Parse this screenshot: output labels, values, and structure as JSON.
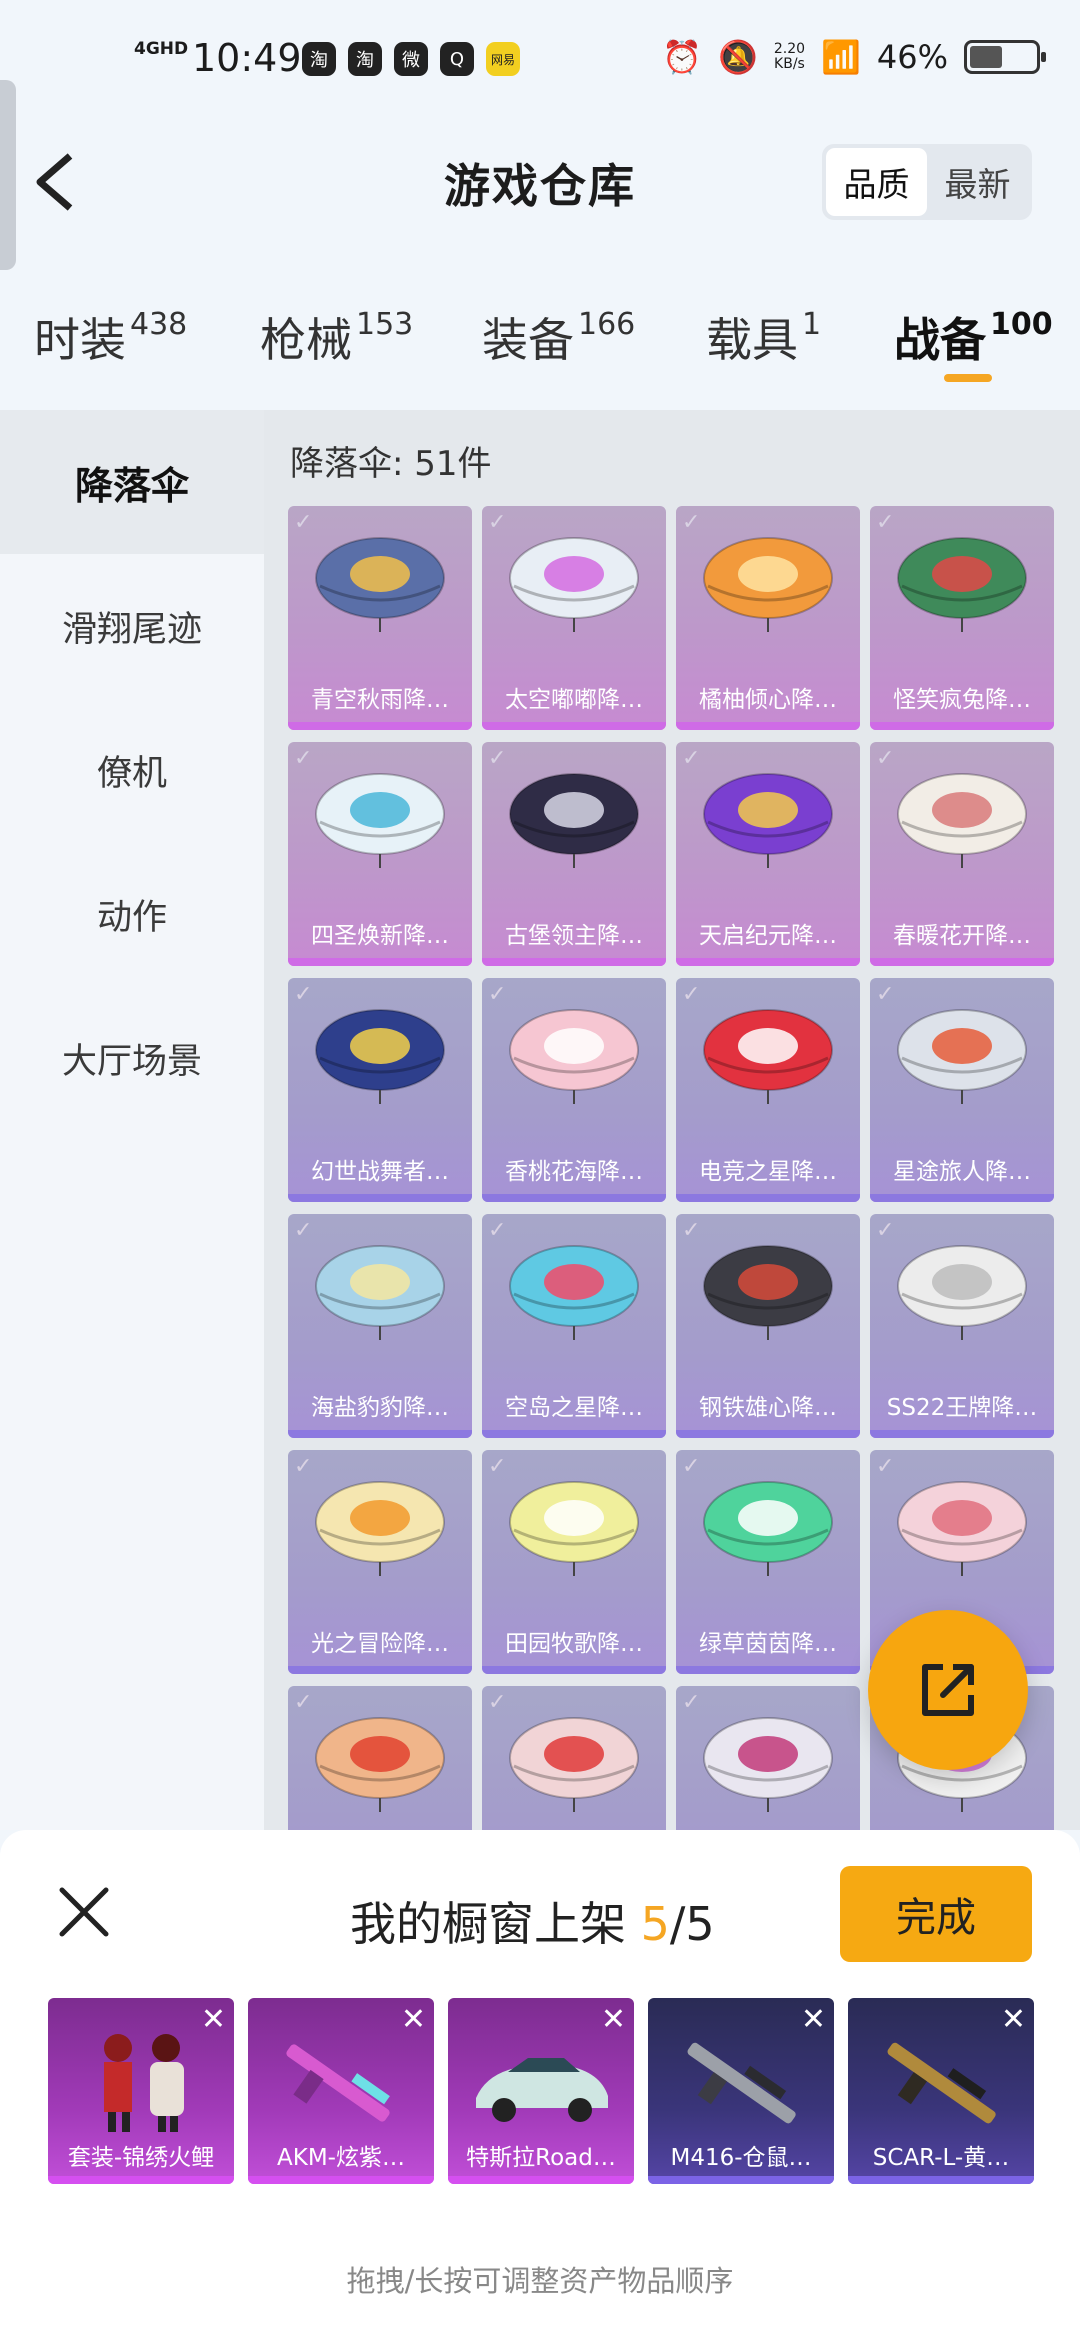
{
  "status_bar": {
    "network": "4GHD",
    "time": "10:49",
    "apps": [
      "淘",
      "淘",
      "微",
      "Q",
      "网易"
    ],
    "speed": "2.20",
    "speed_unit": "KB/s",
    "battery": "46%"
  },
  "header": {
    "title": "游戏仓库",
    "sort_options": [
      "品质",
      "最新"
    ],
    "sort_active": 0
  },
  "tabs": [
    {
      "label": "时装",
      "count": "438"
    },
    {
      "label": "枪械",
      "count": "153"
    },
    {
      "label": "装备",
      "count": "166"
    },
    {
      "label": "载具",
      "count": "1"
    },
    {
      "label": "战备",
      "count": "100"
    }
  ],
  "active_tab": "战备",
  "side_menu": [
    "降落伞",
    "滑翔尾迹",
    "僚机",
    "动作",
    "大厅场景"
  ],
  "section_count": "降落伞: 51件",
  "items": [
    {
      "name": "青空秋雨降…",
      "color": "#5a6fa8",
      "accent": "#f2c04a"
    },
    {
      "name": "太空嘟嘟降…",
      "color": "#e8eef5",
      "accent": "#d36be0"
    },
    {
      "name": "橘柚倾心降…",
      "color": "#f29a3c",
      "accent": "#ffe3a0"
    },
    {
      "name": "怪笑疯兔降…",
      "color": "#3f8a5a",
      "accent": "#e04848"
    },
    {
      "name": "四圣焕新降…",
      "color": "#e7f2f8",
      "accent": "#4ab7d9"
    },
    {
      "name": "古堡领主降…",
      "color": "#2f2c46",
      "accent": "#d7d7e6"
    },
    {
      "name": "天启纪元降…",
      "color": "#7a3fd0",
      "accent": "#f2c94c"
    },
    {
      "name": "春暖花开降…",
      "color": "#f2ede6",
      "accent": "#d97a7a"
    },
    {
      "name": "幻世战舞者…",
      "color": "#2e3f8c",
      "accent": "#f2d04a"
    },
    {
      "name": "香桃花海降…",
      "color": "#f6c6d2",
      "accent": "#ffffff"
    },
    {
      "name": "电竞之星降…",
      "color": "#e2323f",
      "accent": "#ffffff"
    },
    {
      "name": "星途旅人降…",
      "color": "#dde2ea",
      "accent": "#e65d3a"
    },
    {
      "name": "海盐豹豹降…",
      "color": "#a8d3e8",
      "accent": "#f5e6a0"
    },
    {
      "name": "空岛之星降…",
      "color": "#5fc9e3",
      "accent": "#f24b6a"
    },
    {
      "name": "钢铁雄心降…",
      "color": "#3c3c44",
      "accent": "#d64a3a"
    },
    {
      "name": "SS22王牌降…",
      "color": "#ececec",
      "accent": "#bdbdbd"
    },
    {
      "name": "光之冒险降…",
      "color": "#f5e6b0",
      "accent": "#f29a2e"
    },
    {
      "name": "田园牧歌降…",
      "color": "#f0ef9c",
      "accent": "#ffffff"
    },
    {
      "name": "绿草茵茵降…",
      "color": "#4fd39c",
      "accent": "#ffffff"
    },
    {
      "name": "",
      "color": "#f4d2da",
      "accent": "#e0707e"
    },
    {
      "name": "",
      "color": "#f0b58a",
      "accent": "#e2432f"
    },
    {
      "name": "",
      "color": "#f1d4d6",
      "accent": "#e03a3a"
    },
    {
      "name": "",
      "color": "#e9e6f0",
      "accent": "#c23a7a"
    },
    {
      "name": "",
      "color": "#f0f0f0",
      "accent": "#d06bd8"
    }
  ],
  "sheet": {
    "title": "我的橱窗上架 ",
    "count_current": "5",
    "count_sep": "/",
    "count_total": "5",
    "done_label": "完成",
    "hint": "拖拽/长按可调整资产物品顺序",
    "slots": [
      {
        "name": "套装-锦绣火鲤",
        "style": "purple",
        "art": "costume"
      },
      {
        "name": "AKM-炫紫…",
        "style": "purple",
        "art": "rifle-pink"
      },
      {
        "name": "特斯拉Road…",
        "style": "purple",
        "art": "car"
      },
      {
        "name": "M416-仓鼠…",
        "style": "dark",
        "art": "rifle-gray"
      },
      {
        "name": "SCAR-L-黄…",
        "style": "dark",
        "art": "rifle-gold"
      }
    ]
  }
}
